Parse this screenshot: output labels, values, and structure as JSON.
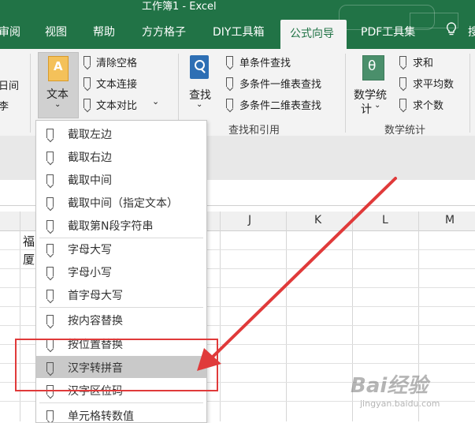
{
  "window": {
    "title": "工作簿1 - Excel"
  },
  "tabs": [
    {
      "label": "审阅"
    },
    {
      "label": "视图"
    },
    {
      "label": "帮助"
    },
    {
      "label": "方方格子"
    },
    {
      "label": "DIY工具箱"
    },
    {
      "label": "公式向导"
    },
    {
      "label": "PDF工具集"
    },
    {
      "label": "搜"
    }
  ],
  "ribbon": {
    "left_cut": [
      "日间",
      "李"
    ],
    "text_button": "文本",
    "text_tools": [
      "清除空格",
      "文本连接",
      "文本对比"
    ],
    "find_button": "查找",
    "find_tools": [
      "单条件查找",
      "多条件一维表查找",
      "多条件二维表查找"
    ],
    "find_group": "查找和引用",
    "math_button": [
      "数学统",
      "计"
    ],
    "math_tools": [
      "求和",
      "求平均数",
      "求个数"
    ],
    "math_group": "数学统计"
  },
  "sheet": {
    "columns": [
      "J",
      "K",
      "L",
      "M"
    ],
    "cells": [
      "福",
      "厦"
    ]
  },
  "menu": {
    "items": [
      "截取左边",
      "截取右边",
      "截取中间",
      "截取中间（指定文本）",
      "截取第N段字符串",
      "字母大写",
      "字母小写",
      "首字母大写",
      "按内容替换",
      "按位置替换",
      "汉字转拼音",
      "汉字区位码",
      "单元格转数值"
    ],
    "selected": "汉字转拼音"
  },
  "watermark": {
    "brand": "Bai经验",
    "url": "jingyan.baidu.com"
  },
  "colors": {
    "excel_green": "#217346",
    "highlight": "#c9c9c9",
    "annotation_red": "#e03a3a"
  }
}
